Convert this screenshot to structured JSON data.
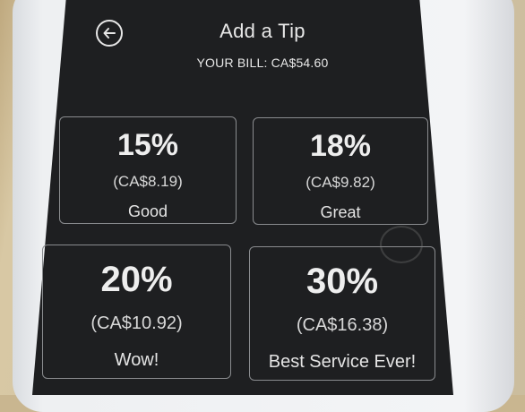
{
  "header": {
    "title": "Add a Tip",
    "bill": "YOUR BILL: CA$54.60",
    "back_icon": "back-arrow-circle-icon"
  },
  "options": [
    {
      "percent": "15%",
      "amount": "(CA$8.19)",
      "label": "Good"
    },
    {
      "percent": "18%",
      "amount": "(CA$9.82)",
      "label": "Great"
    },
    {
      "percent": "20%",
      "amount": "(CA$10.92)",
      "label": "Wow!"
    },
    {
      "percent": "30%",
      "amount": "(CA$16.38)",
      "label": "Best Service Ever!"
    }
  ],
  "colors": {
    "screen_bg": "#1e1f21",
    "text": "#e8e8e8",
    "tile_border": "#8a8c8f"
  }
}
